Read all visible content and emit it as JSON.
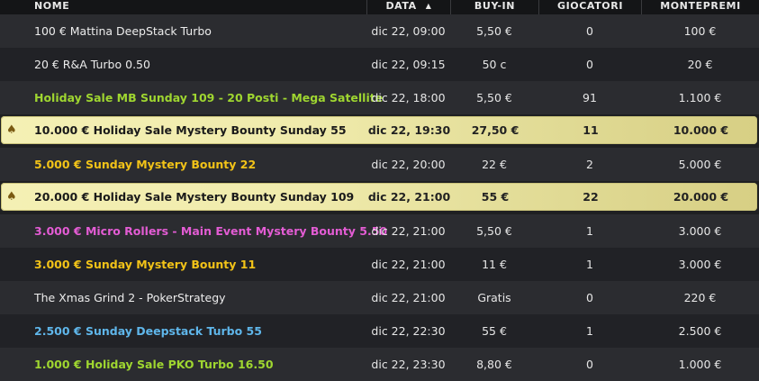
{
  "header": {
    "columns": [
      "NOME",
      "DATA",
      "BUY-IN",
      "GIOCATORI",
      "MONTEPREMI"
    ],
    "sort_icon": "sort-up-icon"
  },
  "colors": {
    "white": "#ececec",
    "green": "#9fd630",
    "yellow": "#f2c318",
    "pink": "#e35cd4",
    "blue": "#5fb6ea",
    "featured_bg": "#f0ebac"
  },
  "rows": [
    {
      "name": "100 € Mattina DeepStack Turbo",
      "date": "dic 22, 09:00",
      "buyin": "5,50 €",
      "players": "0",
      "prize": "100 €",
      "color": "white",
      "featured": false
    },
    {
      "name": "20 € R&A Turbo 0.50",
      "date": "dic 22, 09:15",
      "buyin": "50 c",
      "players": "0",
      "prize": "20 €",
      "color": "white",
      "featured": false
    },
    {
      "name": "Holiday Sale MB Sunday 109 - 20 Posti - Mega Satellite",
      "date": "dic 22, 18:00",
      "buyin": "5,50 €",
      "players": "91",
      "prize": "1.100 €",
      "color": "green",
      "featured": false
    },
    {
      "name": "10.000 € Holiday Sale Mystery Bounty Sunday 55",
      "date": "dic 22, 19:30",
      "buyin": "27,50 €",
      "players": "11",
      "prize": "10.000 €",
      "color": "dark",
      "featured": true
    },
    {
      "name": "5.000 € Sunday Mystery Bounty 22",
      "date": "dic 22, 20:00",
      "buyin": "22 €",
      "players": "2",
      "prize": "5.000 €",
      "color": "yellow",
      "featured": false
    },
    {
      "name": "20.000 € Holiday Sale Mystery Bounty Sunday 109",
      "date": "dic 22, 21:00",
      "buyin": "55 €",
      "players": "22",
      "prize": "20.000 €",
      "color": "dark",
      "featured": true
    },
    {
      "name": "3.000 € Micro Rollers - Main Event Mystery Bounty 5.50",
      "date": "dic 22, 21:00",
      "buyin": "5,50 €",
      "players": "1",
      "prize": "3.000 €",
      "color": "pink",
      "featured": false
    },
    {
      "name": "3.000 € Sunday Mystery Bounty 11",
      "date": "dic 22, 21:00",
      "buyin": "11 €",
      "players": "1",
      "prize": "3.000 €",
      "color": "yellow",
      "featured": false
    },
    {
      "name": "The Xmas Grind 2 - PokerStrategy",
      "date": "dic 22, 21:00",
      "buyin": "Gratis",
      "players": "0",
      "prize": "220 €",
      "color": "white",
      "featured": false
    },
    {
      "name": "2.500 € Sunday Deepstack Turbo 55",
      "date": "dic 22, 22:30",
      "buyin": "55 €",
      "players": "1",
      "prize": "2.500 €",
      "color": "blue",
      "featured": false
    },
    {
      "name": "1.000 € Holiday Sale PKO Turbo 16.50",
      "date": "dic 22, 23:30",
      "buyin": "8,80 €",
      "players": "0",
      "prize": "1.000 €",
      "color": "green",
      "featured": false
    }
  ]
}
